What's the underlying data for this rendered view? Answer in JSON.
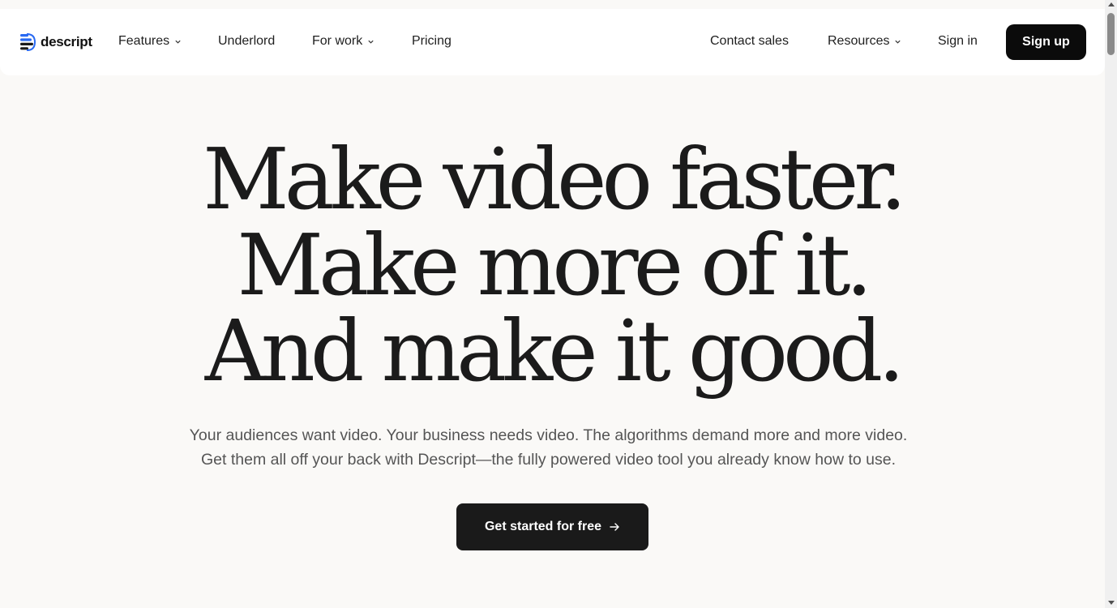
{
  "brand": {
    "name": "descript",
    "accent_color": "#2a6af2"
  },
  "nav": {
    "left_items": [
      {
        "label": "Features",
        "has_dropdown": true
      },
      {
        "label": "Underlord",
        "has_dropdown": false
      },
      {
        "label": "For work",
        "has_dropdown": true
      },
      {
        "label": "Pricing",
        "has_dropdown": false
      }
    ],
    "right_items": [
      {
        "label": "Contact sales",
        "has_dropdown": false
      },
      {
        "label": "Resources",
        "has_dropdown": true
      },
      {
        "label": "Sign in",
        "has_dropdown": false
      }
    ],
    "signup_label": "Sign up"
  },
  "hero": {
    "title_lines": [
      "Make video faster.",
      "Make more of it.",
      "And make it good."
    ],
    "subtitle_lines": [
      "Your audiences want video. Your business needs video. The algorithms demand more and more video.",
      "Get them all off your back with Descript—the fully powered video tool you already know how to use."
    ],
    "cta_label": "Get started for free",
    "cta_icon": "arrow-right-icon"
  },
  "colors": {
    "page_background": "#faf9f7",
    "header_background": "#ffffff",
    "button_dark": "#0b0b0b",
    "cta_background": "#1a1a1a",
    "subtitle_text": "#555555"
  }
}
